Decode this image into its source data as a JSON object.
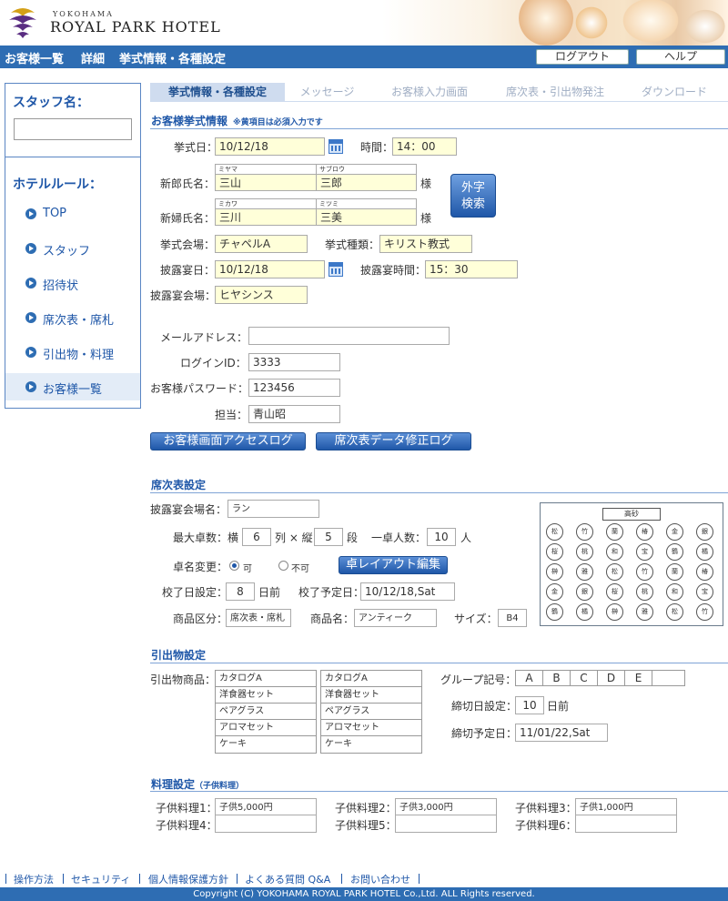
{
  "header": {
    "logo_small": "YOKOHAMA",
    "logo_big": "ROYAL PARK HOTEL",
    "breadcrumb": [
      "お客様一覧",
      "詳細",
      "挙式情報・各種設定"
    ],
    "logout_label": "ログアウト",
    "help_label": "ヘルプ"
  },
  "sidebar": {
    "staff_label": "スタッフ名：",
    "staff_value": "",
    "rules_label": "ホテルルール：",
    "items": [
      {
        "label": "TOP"
      },
      {
        "label": "スタッフ"
      },
      {
        "label": "招待状"
      },
      {
        "label": "席次表・席札"
      },
      {
        "label": "引出物・料理"
      },
      {
        "label": "お客様一覧"
      }
    ]
  },
  "tabs": [
    {
      "label": "挙式情報・各種設定"
    },
    {
      "label": "メッセージ"
    },
    {
      "label": "お客様入力画面"
    },
    {
      "label": "席次表・引出物発注"
    },
    {
      "label": "ダウンロード"
    }
  ],
  "ceremony": {
    "title": "お客様挙式情報",
    "note": "※黄項目は必須入力です",
    "date_label": "挙式日：",
    "date_value": "10/12/18",
    "time_label": "時間：",
    "time_value": "14：00",
    "groom_label": "新郎氏名：",
    "groom_last_kana": "ミヤマ",
    "groom_first_kana": "サブロウ",
    "groom_last": "三山",
    "groom_first": "三郎",
    "bride_label": "新婦氏名：",
    "bride_last_kana": "ミカワ",
    "bride_first_kana": "ミツミ",
    "bride_last": "三川",
    "bride_first": "三美",
    "sama": "様",
    "gaiji_line1": "外字",
    "gaiji_line2": "検索",
    "venue_label": "挙式会場：",
    "venue_value": "チャペルA",
    "type_label": "挙式種類：",
    "type_value": "キリスト教式",
    "reception_date_label": "披露宴日：",
    "reception_date_value": "10/12/18",
    "reception_time_label": "披露宴時間：",
    "reception_time_value": "15：30",
    "reception_venue_label": "披露宴会場：",
    "reception_venue_value": "ヒヤシンス",
    "mail_label": "メールアドレス：",
    "mail_value": "",
    "login_label": "ログインID：",
    "login_value": "3333",
    "password_label": "お客様パスワード：",
    "password_value": "123456",
    "staff_label": "担当：",
    "staff_value": "青山昭",
    "access_log_button": "お客様画面アクセスログ",
    "seat_log_button": "席次表データ修正ログ"
  },
  "seating": {
    "title": "席次表設定",
    "hall_label": "披露宴会場名：",
    "hall_value": "ラン",
    "max_tables_label": "最大卓数：横",
    "cols_value": "6",
    "cols_unit": "列 × 縦",
    "rows_value": "5",
    "rows_unit": "段",
    "per_table_label": "一卓人数：",
    "per_table_value": "10",
    "per_table_unit": "人",
    "rename_label": "卓名変更：",
    "allow_label": "可",
    "deny_label": "不可",
    "allow_selected": true,
    "layout_button": "卓レイアウト編集",
    "proof_label": "校了日設定：",
    "proof_value": "8",
    "proof_unit": "日前",
    "proof_due_label": "校了予定日：",
    "proof_due_value": "10/12/18,Sat",
    "category_label": "商品区分：",
    "category_value": "席次表・席札",
    "product_label": "商品名：",
    "product_value": "アンティーク",
    "size_label": "サイズ：",
    "size_value": "B4",
    "map_head": "高砂",
    "map_tables": [
      [
        "松",
        "竹",
        "蘭",
        "椿",
        "金",
        "銀"
      ],
      [
        "桜",
        "桃",
        "和",
        "宝",
        "鶴",
        "橘"
      ],
      [
        "榊",
        "雅",
        "松",
        "竹",
        "蘭",
        "椿"
      ],
      [
        "金",
        "銀",
        "桜",
        "桃",
        "和",
        "宝"
      ],
      [
        "鶴",
        "橘",
        "榊",
        "雅",
        "松",
        "竹"
      ]
    ]
  },
  "gifts": {
    "title": "引出物設定",
    "products_label": "引出物商品：",
    "list1": [
      "カタログA",
      "洋食器セット",
      "ペアグラス",
      "アロマセット",
      "ケーキ"
    ],
    "list2": [
      "カタログA",
      "洋食器セット",
      "ペアグラス",
      "アロマセット",
      "ケーキ"
    ],
    "group_label": "グループ記号：",
    "groups": [
      "A",
      "B",
      "C",
      "D",
      "E",
      ""
    ],
    "deadline_label": "締切日設定：",
    "deadline_value": "10",
    "deadline_unit": "日前",
    "deadline_due_label": "締切予定日：",
    "deadline_due_value": "11/01/22,Sat"
  },
  "cuisine": {
    "title": "料理設定",
    "subtitle": "（子供料理）",
    "items": [
      {
        "label": "子供料理1：",
        "value": "子供5,000円"
      },
      {
        "label": "子供料理2：",
        "value": "子供3,000円"
      },
      {
        "label": "子供料理3：",
        "value": "子供1,000円"
      },
      {
        "label": "子供料理4：",
        "value": ""
      },
      {
        "label": "子供料理5：",
        "value": ""
      },
      {
        "label": "子供料理6：",
        "value": ""
      }
    ]
  },
  "footer": {
    "links": [
      "操作方法",
      "セキュリティ",
      "個人情報保護方針",
      "よくある質問 Q&A",
      "お問い合わせ"
    ],
    "copyright": "Copyright (C) YOKOHAMA ROYAL PARK HOTEL Co.,Ltd. ALL Rights reserved."
  },
  "colors": {
    "brand": "#2e6db3",
    "required_field": "#ffffd9",
    "accent": "#1f57a8"
  }
}
